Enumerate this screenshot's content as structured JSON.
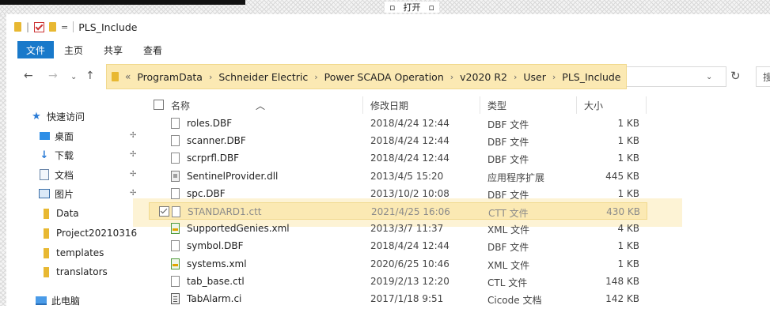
{
  "top_strip": {
    "restore_icon": "restore-icon",
    "open_label": "打开",
    "menu_icon": "menu-icon"
  },
  "titlebar": {
    "separator": "|",
    "quick_access_dropdown": "=",
    "title": "PLS_Include"
  },
  "ribbon": {
    "tabs": [
      "文件",
      "主页",
      "共享",
      "查看"
    ]
  },
  "address": {
    "prefix": "«",
    "crumbs": [
      "ProgramData",
      "Schneider Electric",
      "Power SCADA Operation",
      "v2020 R2",
      "User",
      "PLS_Include"
    ],
    "search_fragment": "搜"
  },
  "sidebar": {
    "items": [
      {
        "label": "快速访问",
        "icon": "star-icon",
        "pinned": false
      },
      {
        "label": "桌面",
        "icon": "desktop-icon",
        "pinned": true
      },
      {
        "label": "下载",
        "icon": "download-icon",
        "pinned": true
      },
      {
        "label": "文档",
        "icon": "document-icon",
        "pinned": true
      },
      {
        "label": "图片",
        "icon": "pictures-icon",
        "pinned": true
      },
      {
        "label": "Data",
        "icon": "folder-icon",
        "pinned": false
      },
      {
        "label": "Project20210316",
        "icon": "folder-icon",
        "pinned": false
      },
      {
        "label": "templates",
        "icon": "folder-icon",
        "pinned": false
      },
      {
        "label": "translators",
        "icon": "folder-icon",
        "pinned": false
      },
      {
        "label": "此电脑",
        "icon": "computer-icon",
        "pinned": false
      }
    ]
  },
  "columns": {
    "name": "名称",
    "date": "修改日期",
    "type": "类型",
    "size": "大小"
  },
  "files": [
    {
      "name": "roles.DBF",
      "date": "2018/4/24 12:44",
      "type": "DBF 文件",
      "size": "1 KB",
      "icon": "file-icon"
    },
    {
      "name": "scanner.DBF",
      "date": "2018/4/24 12:44",
      "type": "DBF 文件",
      "size": "1 KB",
      "icon": "file-icon"
    },
    {
      "name": "scrprfl.DBF",
      "date": "2018/4/24 12:44",
      "type": "DBF 文件",
      "size": "1 KB",
      "icon": "file-icon"
    },
    {
      "name": "SentinelProvider.dll",
      "date": "2013/4/5 15:20",
      "type": "应用程序扩展",
      "size": "445 KB",
      "icon": "dll-icon"
    },
    {
      "name": "spc.DBF",
      "date": "2013/10/2 10:08",
      "type": "DBF 文件",
      "size": "1 KB",
      "icon": "file-icon"
    },
    {
      "name": "STANDARD1.ctt",
      "date": "2021/4/25 16:06",
      "type": "CTT 文件",
      "size": "430 KB",
      "icon": "file-icon",
      "selected": true
    },
    {
      "name": "SupportedGenies.xml",
      "date": "2013/3/7 11:37",
      "type": "XML 文件",
      "size": "4 KB",
      "icon": "xml-icon"
    },
    {
      "name": "symbol.DBF",
      "date": "2018/4/24 12:44",
      "type": "DBF 文件",
      "size": "1 KB",
      "icon": "file-icon"
    },
    {
      "name": "systems.xml",
      "date": "2020/6/25 10:46",
      "type": "XML 文件",
      "size": "1 KB",
      "icon": "xml-icon"
    },
    {
      "name": "tab_base.ctl",
      "date": "2019/2/13 12:20",
      "type": "CTL 文件",
      "size": "148 KB",
      "icon": "file-icon"
    },
    {
      "name": "TabAlarm.ci",
      "date": "2017/1/18 9:51",
      "type": "Cicode 文档",
      "size": "142 KB",
      "icon": "cicode-icon"
    }
  ],
  "colors": {
    "highlight": "#fbe9b3",
    "file_tab": "#1979ca",
    "folder": "#e8b832"
  }
}
